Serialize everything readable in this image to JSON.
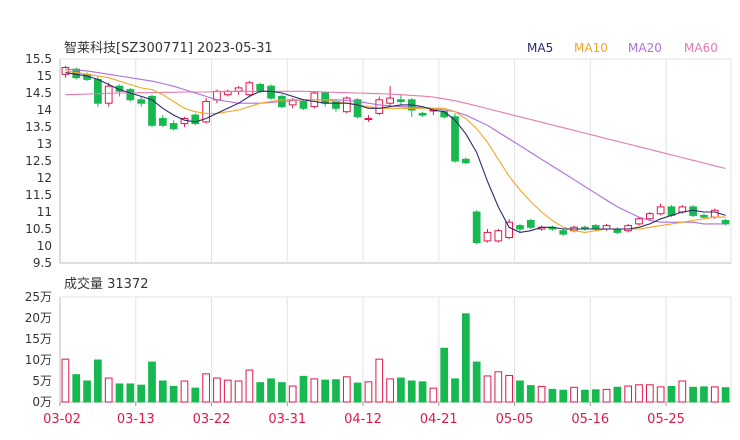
{
  "chart_data": [
    {
      "type": "candlestick",
      "title": "智莱科技[SZ300771] 2023-05-31",
      "ylim": [
        9.5,
        15.5
      ],
      "yticks": [
        "15.5",
        "15",
        "14.5",
        "14",
        "13.5",
        "13",
        "12.5",
        "12",
        "11.5",
        "11",
        "10.5",
        "10",
        "9.5"
      ],
      "legend": [
        {
          "name": "MA5",
          "color": "#2b2b6e"
        },
        {
          "name": "MA10",
          "color": "#f5a623"
        },
        {
          "name": "MA20",
          "color": "#b06fdb"
        },
        {
          "name": "MA60",
          "color": "#e879b0"
        }
      ],
      "colors": {
        "up": "#e0184a",
        "down": "#16b84f"
      },
      "xticks": [
        "03-02",
        "03-13",
        "03-22",
        "03-31",
        "04-12",
        "04-21",
        "05-05",
        "05-16",
        "05-25"
      ],
      "xtick_index": [
        0,
        7,
        14,
        21,
        28,
        35,
        42,
        49,
        56
      ],
      "ohlc": [
        [
          15.05,
          15.25,
          15.3,
          14.95
        ],
        [
          15.2,
          14.95,
          15.25,
          14.9
        ],
        [
          15.05,
          14.9,
          15.1,
          14.85
        ],
        [
          14.9,
          14.2,
          15.0,
          14.1
        ],
        [
          14.2,
          14.7,
          14.8,
          14.1
        ],
        [
          14.7,
          14.55,
          14.75,
          14.4
        ],
        [
          14.6,
          14.3,
          14.65,
          14.25
        ],
        [
          14.3,
          14.2,
          14.4,
          14.1
        ],
        [
          14.4,
          13.55,
          14.45,
          13.5
        ],
        [
          13.75,
          13.55,
          13.85,
          13.5
        ],
        [
          13.6,
          13.45,
          13.7,
          13.4
        ],
        [
          13.6,
          13.75,
          13.8,
          13.5
        ],
        [
          13.85,
          13.6,
          13.9,
          13.55
        ],
        [
          13.65,
          14.25,
          14.35,
          13.6
        ],
        [
          14.3,
          14.55,
          14.6,
          14.2
        ],
        [
          14.45,
          14.55,
          14.6,
          14.4
        ],
        [
          14.55,
          14.65,
          14.7,
          14.45
        ],
        [
          14.45,
          14.8,
          14.85,
          14.4
        ],
        [
          14.75,
          14.55,
          14.8,
          14.5
        ],
        [
          14.7,
          14.35,
          14.75,
          14.3
        ],
        [
          14.4,
          14.1,
          14.45,
          14.05
        ],
        [
          14.15,
          14.3,
          14.35,
          14.05
        ],
        [
          14.25,
          14.05,
          14.3,
          14.0
        ],
        [
          14.1,
          14.5,
          14.55,
          14.05
        ],
        [
          14.5,
          14.2,
          14.55,
          14.1
        ],
        [
          14.25,
          14.05,
          14.3,
          13.95
        ],
        [
          13.95,
          14.35,
          14.4,
          13.9
        ],
        [
          14.3,
          13.8,
          14.35,
          13.75
        ],
        [
          13.75,
          13.75,
          13.85,
          13.65
        ],
        [
          13.9,
          14.3,
          14.4,
          13.85
        ],
        [
          14.2,
          14.35,
          14.7,
          14.1
        ],
        [
          14.3,
          14.25,
          14.45,
          14.15
        ],
        [
          14.3,
          14.0,
          14.35,
          13.8
        ],
        [
          13.9,
          13.85,
          13.95,
          13.8
        ],
        [
          14.0,
          14.0,
          14.05,
          13.85
        ],
        [
          13.95,
          13.8,
          14.0,
          13.75
        ],
        [
          13.8,
          12.5,
          13.9,
          12.45
        ],
        [
          12.55,
          12.45,
          12.6,
          12.4
        ],
        [
          11.0,
          10.1,
          11.05,
          10.05
        ],
        [
          10.15,
          10.4,
          10.5,
          10.1
        ],
        [
          10.15,
          10.45,
          10.5,
          10.1
        ],
        [
          10.25,
          10.7,
          10.8,
          10.2
        ],
        [
          10.6,
          10.5,
          10.65,
          10.4
        ],
        [
          10.75,
          10.55,
          10.8,
          10.5
        ],
        [
          10.5,
          10.55,
          10.6,
          10.45
        ],
        [
          10.55,
          10.5,
          10.6,
          10.45
        ],
        [
          10.45,
          10.35,
          10.5,
          10.3
        ],
        [
          10.45,
          10.55,
          10.6,
          10.4
        ],
        [
          10.55,
          10.5,
          10.6,
          10.45
        ],
        [
          10.6,
          10.5,
          10.65,
          10.45
        ],
        [
          10.5,
          10.6,
          10.65,
          10.45
        ],
        [
          10.5,
          10.4,
          10.55,
          10.35
        ],
        [
          10.45,
          10.6,
          10.65,
          10.4
        ],
        [
          10.65,
          10.8,
          10.85,
          10.6
        ],
        [
          10.8,
          10.95,
          11.0,
          10.75
        ],
        [
          10.95,
          11.15,
          11.25,
          10.9
        ],
        [
          11.15,
          10.9,
          11.2,
          10.85
        ],
        [
          11.0,
          11.15,
          11.2,
          10.95
        ],
        [
          11.15,
          10.9,
          11.2,
          10.85
        ],
        [
          10.9,
          10.85,
          10.95,
          10.8
        ],
        [
          10.85,
          11.05,
          11.1,
          10.8
        ],
        [
          10.75,
          10.65,
          10.8,
          10.6
        ]
      ],
      "ma5": [
        15.1,
        15.05,
        15.0,
        14.9,
        14.75,
        14.6,
        14.5,
        14.4,
        14.3,
        14.05,
        13.85,
        13.7,
        13.65,
        13.75,
        13.9,
        14.05,
        14.2,
        14.4,
        14.55,
        14.55,
        14.5,
        14.4,
        14.3,
        14.25,
        14.2,
        14.2,
        14.2,
        14.15,
        14.05,
        14.05,
        14.1,
        14.15,
        14.15,
        14.1,
        14.0,
        13.95,
        13.7,
        13.3,
        12.75,
        11.9,
        11.15,
        10.55,
        10.4,
        10.45,
        10.55,
        10.55,
        10.5,
        10.5,
        10.5,
        10.5,
        10.5,
        10.5,
        10.5,
        10.55,
        10.65,
        10.8,
        10.9,
        11.0,
        11.05,
        11.0,
        11.0,
        10.9
      ],
      "ma10": [
        15.15,
        15.1,
        15.05,
        15.0,
        14.95,
        14.85,
        14.75,
        14.65,
        14.6,
        14.45,
        14.25,
        14.05,
        13.95,
        13.9,
        13.9,
        13.95,
        14.0,
        14.1,
        14.2,
        14.25,
        14.3,
        14.3,
        14.3,
        14.3,
        14.3,
        14.25,
        14.2,
        14.15,
        14.1,
        14.05,
        14.05,
        14.05,
        14.05,
        14.05,
        14.05,
        14.05,
        13.95,
        13.75,
        13.45,
        13.05,
        12.55,
        12.05,
        11.65,
        11.3,
        11.0,
        10.75,
        10.55,
        10.45,
        10.4,
        10.45,
        10.5,
        10.5,
        10.5,
        10.5,
        10.55,
        10.6,
        10.65,
        10.7,
        10.75,
        10.8,
        10.85,
        10.85
      ],
      "ma20": [
        15.2,
        15.18,
        15.15,
        15.1,
        15.05,
        15.0,
        14.95,
        14.9,
        14.85,
        14.78,
        14.7,
        14.6,
        14.5,
        14.4,
        14.3,
        14.25,
        14.2,
        14.2,
        14.2,
        14.22,
        14.25,
        14.27,
        14.3,
        14.3,
        14.3,
        14.3,
        14.28,
        14.25,
        14.2,
        14.15,
        14.12,
        14.1,
        14.08,
        14.08,
        14.05,
        14.0,
        13.95,
        13.85,
        13.7,
        13.55,
        13.35,
        13.15,
        12.95,
        12.75,
        12.55,
        12.35,
        12.15,
        11.95,
        11.75,
        11.55,
        11.35,
        11.15,
        11.0,
        10.85,
        10.75,
        10.7,
        10.7,
        10.7,
        10.7,
        10.65,
        10.65,
        10.65
      ],
      "ma60": [
        14.45,
        14.46,
        14.47,
        14.48,
        14.49,
        14.5,
        14.5,
        14.51,
        14.51,
        14.52,
        14.52,
        14.53,
        14.53,
        14.53,
        14.54,
        14.54,
        14.55,
        14.55,
        14.55,
        14.55,
        14.55,
        14.55,
        14.55,
        14.54,
        14.53,
        14.52,
        14.51,
        14.5,
        14.49,
        14.48,
        14.47,
        14.45,
        14.43,
        14.41,
        14.38,
        14.33,
        14.27,
        14.2,
        14.12,
        14.04,
        13.96,
        13.88,
        13.8,
        13.72,
        13.64,
        13.56,
        13.48,
        13.4,
        13.32,
        13.24,
        13.16,
        13.08,
        13.0,
        12.92,
        12.84,
        12.76,
        12.68,
        12.6,
        12.52,
        12.44,
        12.36,
        12.28
      ]
    },
    {
      "type": "bar",
      "title": "成交量 31372",
      "ylim": [
        0,
        25
      ],
      "yticks": [
        "25万",
        "20万",
        "15万",
        "10万",
        "5万",
        "0万"
      ],
      "volume": [
        10.2,
        6.5,
        5.0,
        10.0,
        5.7,
        4.3,
        4.3,
        4.0,
        9.5,
        5.0,
        3.7,
        5.0,
        3.3,
        6.7,
        5.7,
        5.2,
        5.0,
        7.6,
        4.6,
        5.5,
        4.6,
        3.8,
        6.1,
        5.5,
        5.2,
        5.3,
        6.0,
        4.5,
        4.8,
        10.2,
        5.5,
        5.7,
        5.0,
        4.8,
        3.3,
        12.8,
        5.5,
        21.0,
        9.5,
        6.2,
        7.2,
        6.3,
        5.0,
        3.9,
        3.7,
        3.0,
        2.8,
        3.5,
        2.8,
        2.9,
        3.0,
        3.5,
        3.8,
        4.1,
        4.1,
        3.6,
        3.7,
        5.0,
        3.5,
        3.6,
        3.6,
        3.4
      ]
    }
  ]
}
